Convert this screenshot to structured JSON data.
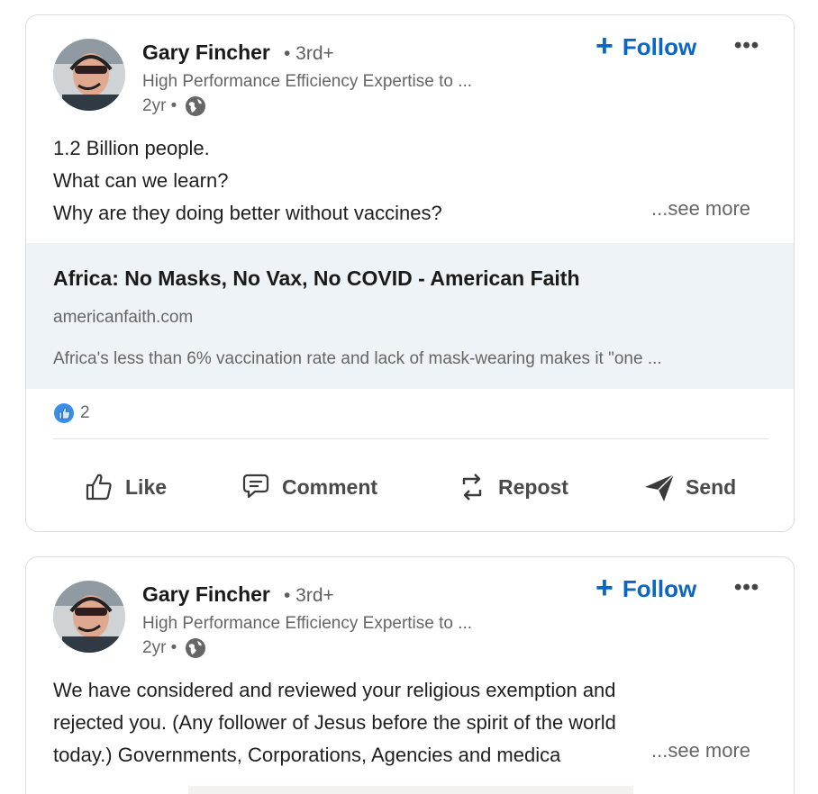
{
  "posts": [
    {
      "author": {
        "name": "Gary Fincher",
        "degree": "• 3rd+",
        "headline": "High Performance Efficiency Expertise to ...",
        "time": "2yr •"
      },
      "follow_label": "Follow",
      "follow_plus": "+",
      "more_label": "•••",
      "body_lines": [
        "1.2 Billion people.",
        "What can we learn?",
        "Why are they doing better without vaccines?"
      ],
      "see_more": "...see more",
      "link": {
        "title": "Africa: No Masks, No Vax, No COVID - American Faith",
        "domain": "americanfaith.com",
        "description": "Africa's less than 6% vaccination rate and lack of mask-wearing makes it \"one ..."
      },
      "reactions": {
        "count": "2",
        "icon": "like-reaction-icon"
      },
      "actions": {
        "like": "Like",
        "comment": "Comment",
        "repost": "Repost",
        "send": "Send"
      }
    },
    {
      "author": {
        "name": "Gary Fincher",
        "degree": "• 3rd+",
        "headline": "High Performance Efficiency Expertise to ...",
        "time": "2yr •"
      },
      "follow_label": "Follow",
      "follow_plus": "+",
      "more_label": "•••",
      "body_lines": [
        "We have considered and reviewed your religious exemption and",
        "rejected you. (Any follower of Jesus before the spirit of the world",
        "today.) Governments, Corporations, Agencies and medica"
      ],
      "see_more": "...see more"
    }
  ],
  "colors": {
    "accent": "#0a66c2",
    "preview_bg": "#eef3f8",
    "muted": "#666666"
  }
}
